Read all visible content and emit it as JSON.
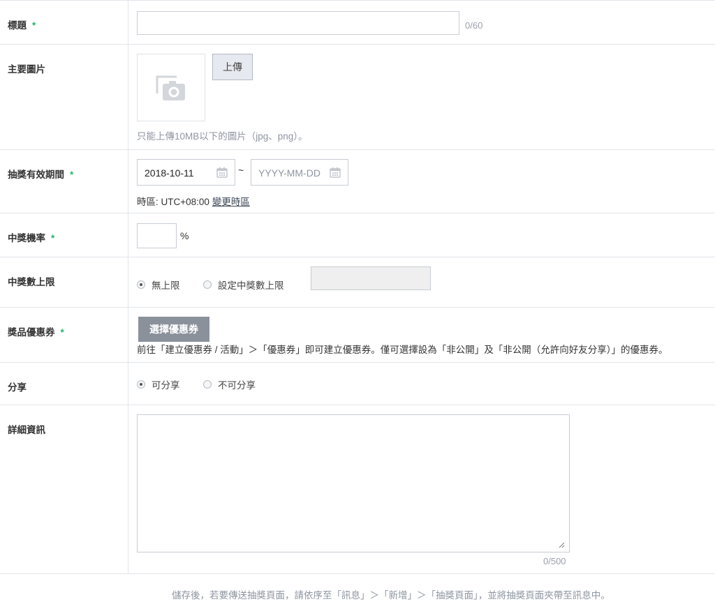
{
  "fields": {
    "title": {
      "label": "標題",
      "required_mark": "*",
      "value": "",
      "counter": "0/60"
    },
    "main_image": {
      "label": "主要圖片",
      "upload_label": "上傳",
      "hint": "只能上傳10MB以下的圖片（jpg、png）。"
    },
    "period": {
      "label": "抽獎有效期間",
      "required_mark": "*",
      "start_value": "2018-10-11",
      "separator": "~",
      "end_placeholder": "YYYY-MM-DD",
      "timezone_text": "時區: UTC+08:00",
      "timezone_link": "變更時區"
    },
    "rate": {
      "label": "中獎機率",
      "required_mark": "*",
      "value": "",
      "unit": "%"
    },
    "limit": {
      "label": "中獎數上限",
      "options": [
        "無上限",
        "設定中獎數上限"
      ],
      "selected": "無上限"
    },
    "prize": {
      "label": "獎品優惠券",
      "required_mark": "*",
      "button_label": "選擇優惠券",
      "note": "前往「建立優惠券 / 活動」＞「優惠券」即可建立優惠券。僅可選擇設為「非公開」及「非公開（允許向好友分享）」的優惠券。"
    },
    "share": {
      "label": "分享",
      "options": [
        "可分享",
        "不可分享"
      ],
      "selected": "可分享"
    },
    "details": {
      "label": "詳細資訊",
      "value": "",
      "counter": "0/500"
    }
  },
  "footer_note": "儲存後，若要傳送抽獎頁面，請依序至「訊息」＞「新增」＞「抽獎頁面」，並將抽獎頁面夾帶至訊息中。"
}
